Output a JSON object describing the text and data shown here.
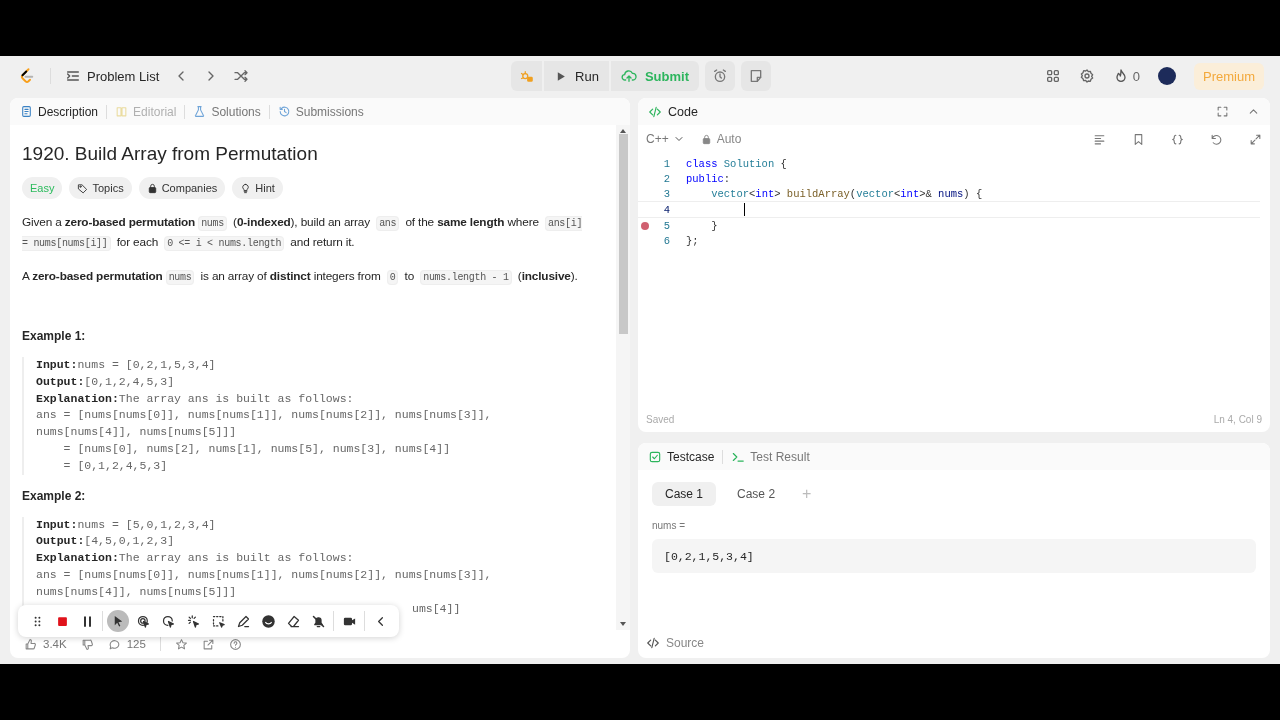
{
  "nav": {
    "problem_list": "Problem List",
    "run": "Run",
    "submit": "Submit",
    "streak": "0",
    "premium": "Premium"
  },
  "left_tabs": [
    {
      "label": "Description",
      "selected": true,
      "disabled": false
    },
    {
      "label": "Editorial",
      "selected": false,
      "disabled": true
    },
    {
      "label": "Solutions",
      "selected": false,
      "disabled": false
    },
    {
      "label": "Submissions",
      "selected": false,
      "disabled": false
    }
  ],
  "problem": {
    "title": "1920. Build Array from Permutation",
    "tags": [
      {
        "label": "Easy",
        "kind": "difficulty",
        "color": "#2cbb5d"
      },
      {
        "label": "Topics",
        "kind": "tag"
      },
      {
        "label": "Companies",
        "kind": "tag"
      },
      {
        "label": "Hint",
        "kind": "tag"
      }
    ],
    "paragraphs": [
      [
        {
          "kind": "text",
          "text": "Given a "
        },
        {
          "kind": "bold",
          "text": "zero-based permutation"
        },
        {
          "kind": "code",
          "text": "nums"
        },
        {
          "kind": "text",
          "text": " ("
        },
        {
          "kind": "bold",
          "text": "0-indexed"
        },
        {
          "kind": "text",
          "text": "), build an array "
        },
        {
          "kind": "code",
          "text": "ans"
        },
        {
          "kind": "text",
          "text": " of the "
        },
        {
          "kind": "bold",
          "text": "same length"
        },
        {
          "kind": "text",
          "text": " where "
        },
        {
          "kind": "code",
          "text": "ans[i] = nums[nums[i]]"
        },
        {
          "kind": "text",
          "text": " for each "
        },
        {
          "kind": "code",
          "text": "0 <= i < nums.length"
        },
        {
          "kind": "text",
          "text": " and return it."
        }
      ],
      [
        {
          "kind": "text",
          "text": "A "
        },
        {
          "kind": "bold",
          "text": "zero-based permutation"
        },
        {
          "kind": "code",
          "text": "nums"
        },
        {
          "kind": "text",
          "text": " is an array of "
        },
        {
          "kind": "bold",
          "text": "distinct"
        },
        {
          "kind": "text",
          "text": " integers from "
        },
        {
          "kind": "code",
          "text": "0"
        },
        {
          "kind": "text",
          "text": " to "
        },
        {
          "kind": "code",
          "text": "nums.length - 1"
        },
        {
          "kind": "text",
          "text": " ("
        },
        {
          "kind": "bold",
          "text": "inclusive"
        },
        {
          "kind": "text",
          "text": ")."
        }
      ]
    ],
    "examples": [
      {
        "heading": "Example 1:",
        "lines": [
          {
            "label": "Input:",
            "text": "nums = [0,2,1,5,3,4]"
          },
          {
            "label": "Output:",
            "text": "[0,1,2,4,5,3]"
          },
          {
            "label": "Explanation:",
            "text": "The array ans is built as follows:"
          },
          {
            "text": "ans = [nums[nums[0]], nums[nums[1]], nums[nums[2]], nums[nums[3]],"
          },
          {
            "text": "nums[nums[4]], nums[nums[5]]]"
          },
          {
            "text": "    = [nums[0], nums[2], nums[1], nums[5], nums[3], nums[4]]"
          },
          {
            "text": "    = [0,1,2,4,5,3]"
          }
        ]
      },
      {
        "heading": "Example 2:",
        "lines": [
          {
            "label": "Input:",
            "text": "nums = [5,0,1,2,3,4]"
          },
          {
            "label": "Output:",
            "text": "[4,5,0,1,2,3]"
          },
          {
            "label": "Explanation:",
            "text": "The array ans is built as follows:"
          },
          {
            "text": "ans = [nums[nums[0]], nums[nums[1]], nums[nums[2]], nums[nums[3]],"
          },
          {
            "text": "nums[nums[4]], nums[nums[5]]]"
          },
          {
            "text": "ums[4]]",
            "kind": "partial"
          }
        ]
      }
    ],
    "stats": {
      "likes": "3.4K",
      "comments": "125"
    }
  },
  "code": {
    "title": "Code",
    "language": "C++",
    "mode": "Auto",
    "lines": [
      {
        "number": "1",
        "breakpoint": false,
        "current": false,
        "tokens": [
          {
            "kind": "keyword",
            "text": "class "
          },
          {
            "kind": "type",
            "text": "Solution"
          },
          {
            "kind": "plain",
            "text": " {"
          }
        ]
      },
      {
        "number": "2",
        "breakpoint": false,
        "current": false,
        "tokens": [
          {
            "kind": "keyword",
            "text": "public"
          },
          {
            "kind": "plain",
            "text": ":"
          }
        ]
      },
      {
        "number": "3",
        "breakpoint": false,
        "current": false,
        "tokens": [
          {
            "kind": "type",
            "text": "    vector"
          },
          {
            "kind": "plain",
            "text": "<"
          },
          {
            "kind": "keyword",
            "text": "int"
          },
          {
            "kind": "plain",
            "text": "> "
          },
          {
            "kind": "function",
            "text": "buildArray"
          },
          {
            "kind": "plain",
            "text": "("
          },
          {
            "kind": "type",
            "text": "vector"
          },
          {
            "kind": "plain",
            "text": "<"
          },
          {
            "kind": "keyword",
            "text": "int"
          },
          {
            "kind": "plain",
            "text": ">& "
          },
          {
            "kind": "variable",
            "text": "nums"
          },
          {
            "kind": "plain",
            "text": ") {"
          }
        ]
      },
      {
        "number": "4",
        "breakpoint": false,
        "current": true
      },
      {
        "number": "5",
        "breakpoint": true,
        "current": false,
        "tokens": [
          {
            "kind": "plain",
            "text": "    }"
          }
        ]
      },
      {
        "number": "6",
        "breakpoint": false,
        "current": false,
        "tokens": [
          {
            "kind": "plain",
            "text": "};"
          }
        ]
      }
    ],
    "status": "Saved",
    "position": "Ln 4, Col 9"
  },
  "testcase": {
    "tabs": [
      {
        "label": "Testcase",
        "selected": true
      },
      {
        "label": "Test Result",
        "selected": false
      }
    ],
    "cases": [
      {
        "label": "Case 1",
        "selected": true
      },
      {
        "label": "Case 2",
        "selected": false
      }
    ],
    "add": "+",
    "param": "nums =",
    "value": "[0,2,1,5,3,4]",
    "source": "Source"
  },
  "recorder": {
    "tools": [
      {
        "selected": false
      },
      {
        "selected": false
      },
      {
        "selected": false
      },
      {
        "selected": true
      },
      {
        "selected": false
      },
      {
        "selected": false
      },
      {
        "selected": false
      },
      {
        "selected": false
      },
      {
        "selected": false
      },
      {
        "selected": false
      },
      {
        "selected": false
      },
      {
        "selected": false
      },
      {
        "selected": false
      },
      {
        "selected": false
      }
    ]
  }
}
